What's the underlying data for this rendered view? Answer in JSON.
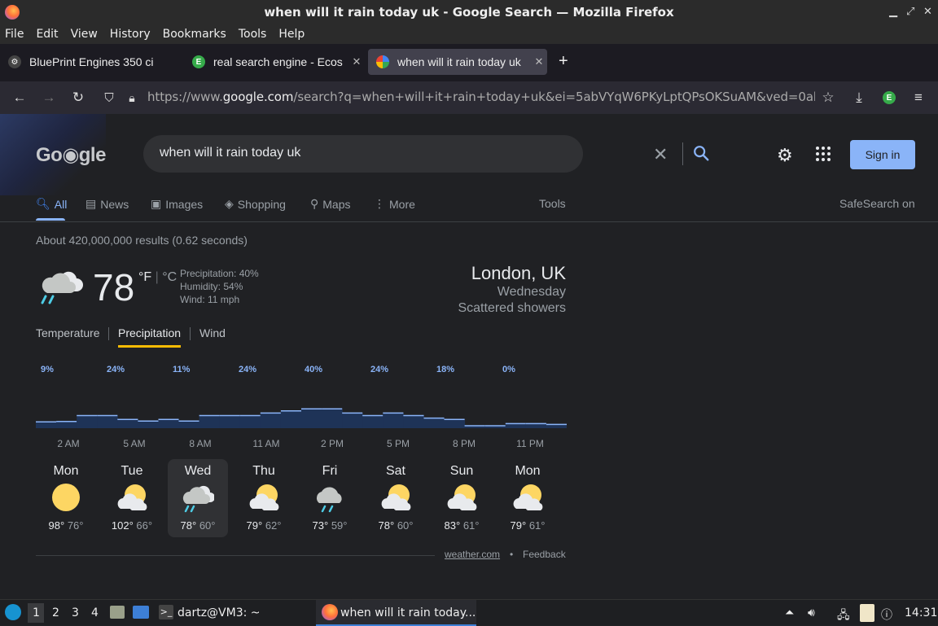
{
  "window": {
    "title": "when will it rain today uk - Google Search — Mozilla Firefox"
  },
  "menu": [
    "File",
    "Edit",
    "View",
    "History",
    "Bookmarks",
    "Tools",
    "Help"
  ],
  "tabs": [
    {
      "label": "BluePrint Engines 350 ci",
      "icon": "gear-favicon",
      "active": false
    },
    {
      "label": "real search engine - Ecos",
      "icon": "ecosia-favicon",
      "active": false
    },
    {
      "label": "when will it rain today uk",
      "icon": "google-favicon",
      "active": true
    }
  ],
  "navbar": {
    "url_prefix": "https://www.",
    "url_host": "google.com",
    "url_rest": "/search?q=when+will+it+rain+today+uk&ei=5abVYqW6PKyLptQPsOKSuAM&ved=0ahUKEw"
  },
  "google": {
    "query": "when will it rain today uk",
    "signin": "Sign in",
    "nav": [
      "All",
      "News",
      "Images",
      "Shopping",
      "Maps",
      "More"
    ],
    "tools": "Tools",
    "safesearch": "SafeSearch on",
    "stats": "About 420,000,000 results (0.62 seconds)"
  },
  "weather": {
    "temp": "78",
    "unit_f": "°F",
    "unit_c": "°C",
    "precipitation": "Precipitation: 40%",
    "humidity": "Humidity: 54%",
    "wind": "Wind: 11 mph",
    "location": "London, UK",
    "day": "Wednesday",
    "condition": "Scattered showers",
    "tabs": [
      "Temperature",
      "Precipitation",
      "Wind"
    ],
    "source": "weather.com",
    "feedback": "Feedback",
    "forecast": [
      {
        "day": "Mon",
        "hi": "98°",
        "lo": "76°",
        "icon": "sunny"
      },
      {
        "day": "Tue",
        "hi": "102°",
        "lo": "66°",
        "icon": "partly-cloudy"
      },
      {
        "day": "Wed",
        "hi": "78°",
        "lo": "60°",
        "icon": "showers",
        "selected": true
      },
      {
        "day": "Thu",
        "hi": "79°",
        "lo": "62°",
        "icon": "partly-cloudy"
      },
      {
        "day": "Fri",
        "hi": "73°",
        "lo": "59°",
        "icon": "rain"
      },
      {
        "day": "Sat",
        "hi": "78°",
        "lo": "60°",
        "icon": "partly-cloudy"
      },
      {
        "day": "Sun",
        "hi": "83°",
        "lo": "61°",
        "icon": "partly-cloudy"
      },
      {
        "day": "Mon",
        "hi": "79°",
        "lo": "61°",
        "icon": "partly-cloudy"
      }
    ]
  },
  "chart_data": {
    "type": "area",
    "title": "",
    "xlabel": "",
    "ylabel": "",
    "ylim": [
      0,
      100
    ],
    "time_labels": [
      "2 AM",
      "5 AM",
      "8 AM",
      "11 AM",
      "2 PM",
      "5 PM",
      "8 PM",
      "11 PM"
    ],
    "percent_labels": [
      "9%",
      "24%",
      "11%",
      "24%",
      "40%",
      "24%",
      "18%",
      "0%"
    ],
    "values": [
      9,
      10,
      24,
      24,
      15,
      11,
      15,
      11,
      24,
      24,
      24,
      30,
      35,
      40,
      40,
      30,
      24,
      30,
      24,
      18,
      15,
      0,
      0,
      5,
      5,
      3
    ]
  },
  "taskbar": {
    "workspaces": [
      "1",
      "2",
      "3",
      "4"
    ],
    "terminal": "dartz@VM3: ~",
    "firefox": "when will it rain today...",
    "clock": "14:31"
  }
}
